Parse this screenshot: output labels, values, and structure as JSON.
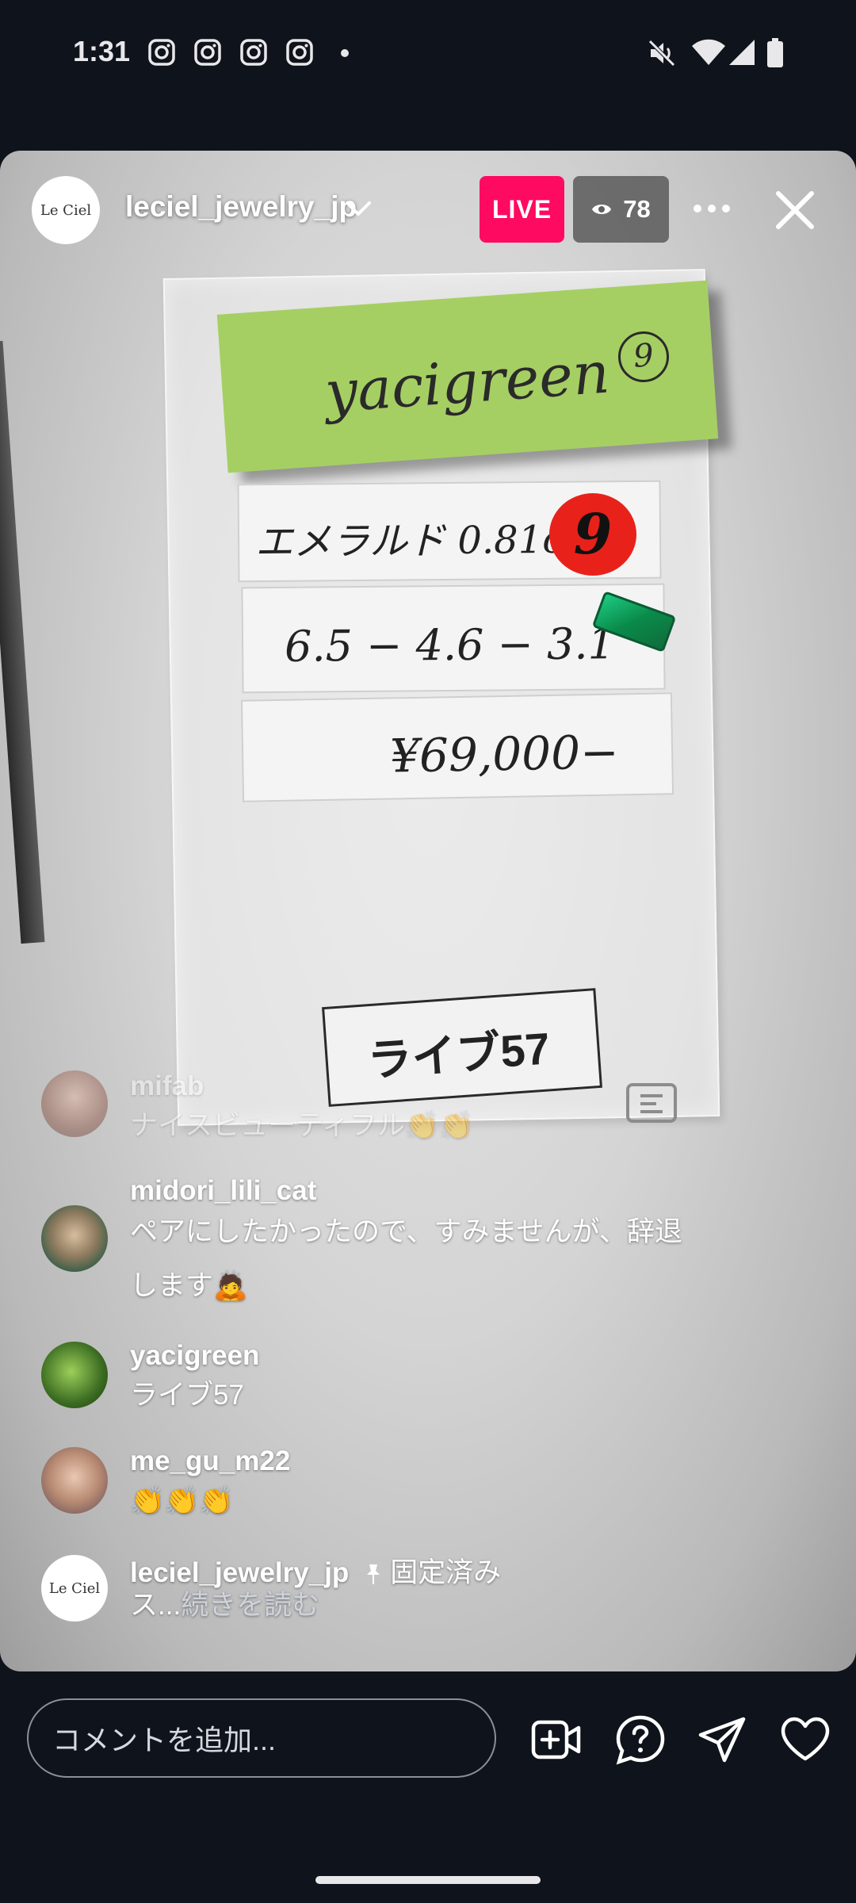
{
  "status_bar": {
    "time": "1:31",
    "notification_icons": [
      "instagram-icon",
      "instagram-icon",
      "instagram-icon",
      "instagram-icon"
    ],
    "system_icons": [
      "mute-icon",
      "wifi-icon",
      "signal-icon",
      "battery-icon"
    ]
  },
  "live": {
    "host_username": "leciel_jewelry_jp",
    "host_avatar_text": "Le Ciel",
    "live_label": "LIVE",
    "viewer_count": "78",
    "accent_color": "#ff0a61"
  },
  "video": {
    "note_text": "yacigreen",
    "note_number": "9",
    "label_1": "エメラルド 0.81ct",
    "label_2": "6.5 − 4.6 − 3.1",
    "label_3": "¥69,000−",
    "red_sticker_number": "9",
    "stamp_text": "ライブ57"
  },
  "comments": [
    {
      "user": "mifab",
      "text": "ナイスビューティフル👏👏"
    },
    {
      "user": "midori_lili_cat",
      "text": "ペアにしたかったので、すみませんが、辞退します🙇"
    },
    {
      "user": "yacigreen",
      "text": "ライブ57"
    },
    {
      "user": "me_gu_m22",
      "text": "👏👏👏"
    },
    {
      "user": "leciel_jewelry_jp",
      "pinned_label": "固定済み",
      "text": "ス...",
      "more_label": "続きを読む"
    }
  ],
  "bottom_bar": {
    "comment_placeholder": "コメントを追加..."
  }
}
